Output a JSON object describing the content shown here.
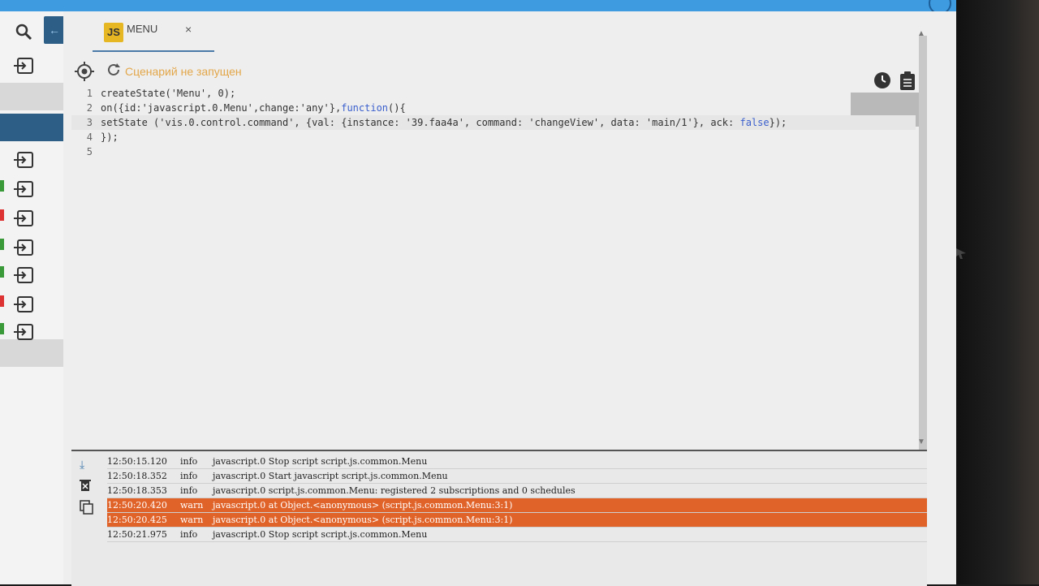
{
  "tab": {
    "badge": "JS",
    "title": "MENU",
    "close": "×"
  },
  "toolbar": {
    "status": "Сценарий не запущен"
  },
  "code": {
    "lines": [
      {
        "num": "1",
        "parts": [
          {
            "t": "createState('Menu', 0);",
            "c": ""
          }
        ]
      },
      {
        "num": "2",
        "parts": [
          {
            "t": "on({id:'javascript.0.Menu',change:'any'},",
            "c": ""
          },
          {
            "t": "function",
            "c": "kw"
          },
          {
            "t": "(){",
            "c": ""
          }
        ]
      },
      {
        "num": "3",
        "parts": [
          {
            "t": "setState ('vis.0.control.command', {val: {instance: '39.faa4a', command: 'changeView', data: 'main/1'}, ack: ",
            "c": ""
          },
          {
            "t": "false",
            "c": "kw"
          },
          {
            "t": "});",
            "c": ""
          }
        ]
      },
      {
        "num": "4",
        "parts": [
          {
            "t": "});",
            "c": ""
          }
        ]
      },
      {
        "num": "5",
        "parts": [
          {
            "t": "",
            "c": ""
          }
        ]
      }
    ]
  },
  "log": {
    "rows": [
      {
        "time": "12:50:15.120",
        "level": "info",
        "msg": "javascript.0 Stop script script.js.common.Menu",
        "warn": false
      },
      {
        "time": "12:50:18.352",
        "level": "info",
        "msg": "javascript.0 Start javascript script.js.common.Menu",
        "warn": false
      },
      {
        "time": "12:50:18.353",
        "level": "info",
        "msg": "javascript.0 script.js.common.Menu: registered 2 subscriptions and 0 schedules",
        "warn": false
      },
      {
        "time": "12:50:20.420",
        "level": "warn",
        "msg": "javascript.0 at Object.<anonymous> (script.js.common.Menu:3:1)",
        "warn": true
      },
      {
        "time": "12:50:20.425",
        "level": "warn",
        "msg": "javascript.0 at Object.<anonymous> (script.js.common.Menu:3:1)",
        "warn": true
      },
      {
        "time": "12:50:21.975",
        "level": "info",
        "msg": "javascript.0 Stop script script.js.common.Menu",
        "warn": false
      }
    ]
  },
  "icons": {
    "search": "search-icon",
    "collapse": "arrow-left-icon",
    "script": "enter-script-icon",
    "target": "crosshair-icon",
    "reload": "reload-icon",
    "clock": "clock-icon",
    "clipboard": "clipboard-icon",
    "download": "download-icon",
    "clear": "clear-log-icon",
    "copy": "copy-icon"
  },
  "colors": {
    "accent": "#2c5e86",
    "status": "#e3a74a",
    "warn": "#e0632a",
    "top": "#3f9be0"
  }
}
